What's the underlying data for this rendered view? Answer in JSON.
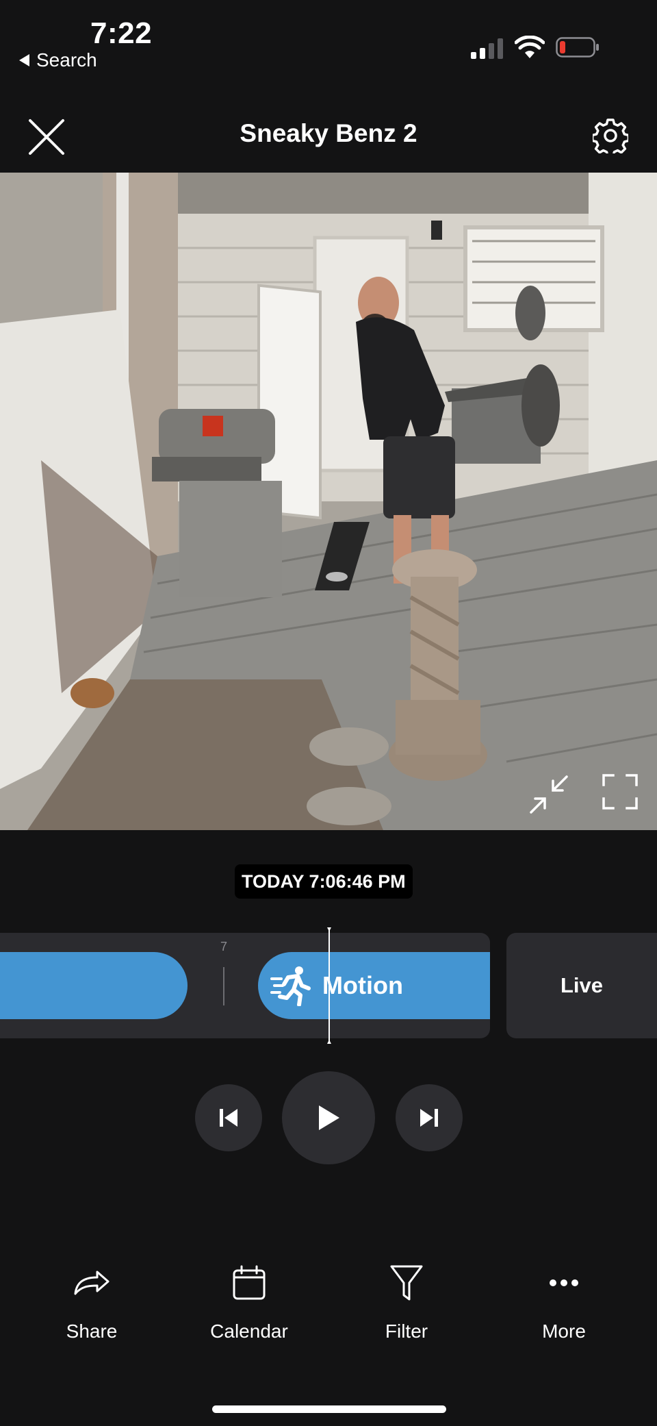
{
  "status_bar": {
    "time": "7:22",
    "back_label": "Search"
  },
  "header": {
    "title": "Sneaky Benz 2",
    "close_icon": "close-icon",
    "settings_icon": "gear-icon"
  },
  "video": {
    "timestamp": "TODAY 7:06:46 PM",
    "minimize_icon": "minimize-icon",
    "fullscreen_icon": "fullscreen-icon"
  },
  "timeline": {
    "tick_label": "7",
    "event_label": "Motion",
    "event_icon": "running-person-icon",
    "live_label": "Live",
    "accent_color": "#4495d2"
  },
  "playback": {
    "prev_icon": "skip-previous-icon",
    "play_icon": "play-icon",
    "next_icon": "skip-next-icon"
  },
  "bottom_bar": {
    "items": [
      {
        "label": "Share",
        "icon": "share-icon"
      },
      {
        "label": "Calendar",
        "icon": "calendar-icon"
      },
      {
        "label": "Filter",
        "icon": "filter-icon"
      },
      {
        "label": "More",
        "icon": "more-icon"
      }
    ]
  }
}
